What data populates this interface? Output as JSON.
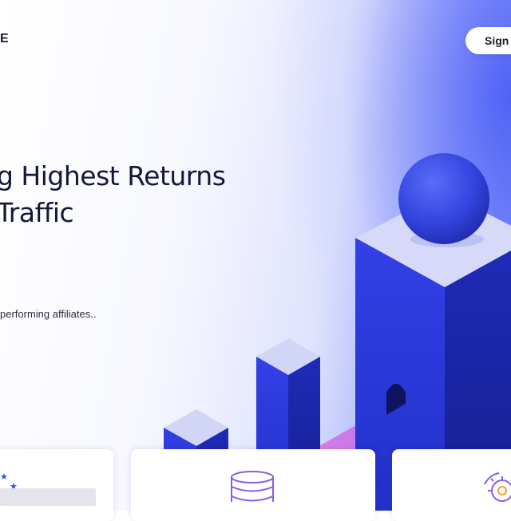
{
  "header": {
    "logo_fragment": "E",
    "signin_label": "Sign In"
  },
  "hero": {
    "headline_line1": "g Highest Returns",
    "headline_line2": "Traffic",
    "subtext": "performing affiliates.."
  },
  "features": {
    "card_1_icon": "stars-icon",
    "card_2_icon": "database-icon",
    "card_3_icon": "gear-icon"
  },
  "colors": {
    "accent": "#3b4cf0",
    "headline": "#16163a",
    "ribbon": "#c77bf0"
  }
}
